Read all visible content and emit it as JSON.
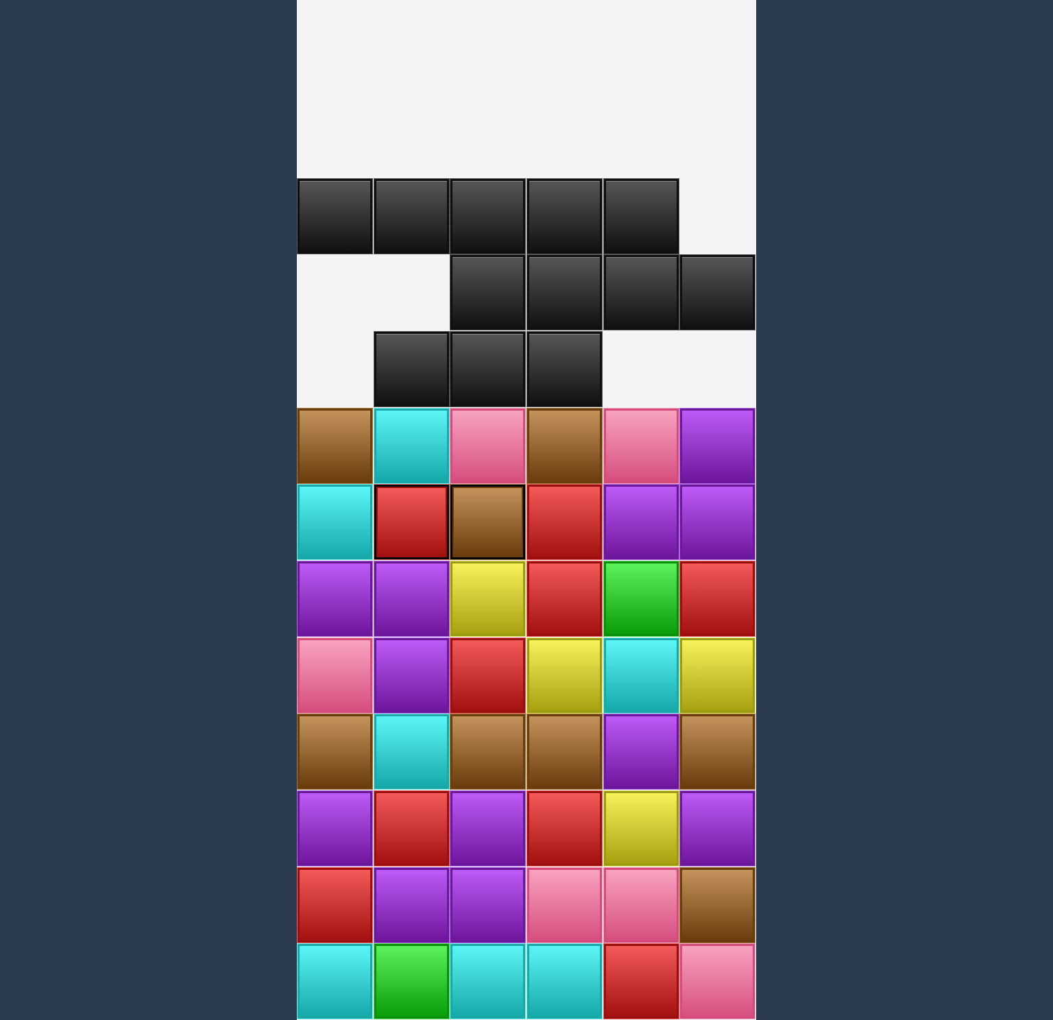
{
  "game": {
    "columns": 6,
    "rows": 14,
    "empty_color": "#f4f4f4",
    "background_color": "#2b3c50",
    "palette": {
      "black": "#1a1a1a",
      "brown": "#9a6329",
      "cyan": "#2ed6d6",
      "pink": "#ea7aa0",
      "purple": "#9a33d1",
      "red": "#d12a2a",
      "yellow": "#d6d030",
      "green": "#22cc22"
    },
    "grid": [
      [
        null,
        null,
        null,
        null,
        null,
        null
      ],
      [
        null,
        null,
        null,
        null,
        null,
        null
      ],
      [
        "black",
        "black",
        "black",
        "black",
        "black",
        null
      ],
      [
        null,
        null,
        "black",
        "black",
        "black",
        "black"
      ],
      [
        null,
        "black",
        "black",
        "black",
        null,
        null
      ],
      [
        "brown",
        "cyan",
        "pink",
        "brown",
        "pink",
        "purple"
      ],
      [
        "cyan",
        "red",
        "brown",
        "red",
        "purple",
        "purple"
      ],
      [
        "purple",
        "purple",
        "yellow",
        "red",
        "green",
        "red"
      ],
      [
        "pink",
        "purple",
        "red",
        "yellow",
        "cyan",
        "yellow"
      ],
      [
        "brown",
        "cyan",
        "brown",
        "brown",
        "purple",
        "brown"
      ],
      [
        "purple",
        "red",
        "purple",
        "red",
        "yellow",
        "purple"
      ],
      [
        "red",
        "purple",
        "purple",
        "pink",
        "pink",
        "brown"
      ],
      [
        "cyan",
        "green",
        "cyan",
        "cyan",
        "red",
        "pink"
      ]
    ],
    "selected_cells": [
      [
        6,
        1
      ],
      [
        6,
        2
      ]
    ]
  }
}
